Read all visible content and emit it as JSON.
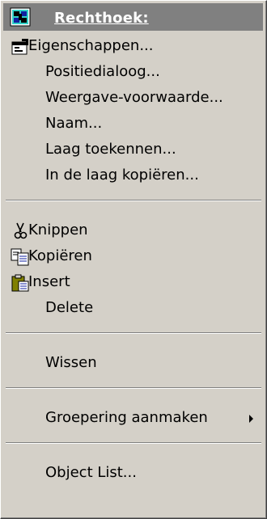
{
  "menu": {
    "header": {
      "label": "Rechthoek:",
      "icon": "rectangle-shape-icon"
    },
    "group1": [
      {
        "label": "Eigenschappen...",
        "icon": "properties-icon"
      },
      {
        "label": "Positiedialoog..."
      },
      {
        "label": "Weergave-voorwaarde..."
      },
      {
        "label": "Naam..."
      },
      {
        "label": "Laag toekennen..."
      },
      {
        "label": "In de laag kopiëren..."
      }
    ],
    "group2": [
      {
        "label": "Knippen",
        "icon": "scissors-icon"
      },
      {
        "label": "Kopiëren",
        "icon": "copy-icon"
      },
      {
        "label": "Insert",
        "icon": "paste-icon"
      },
      {
        "label": "Delete"
      }
    ],
    "group3": [
      {
        "label": "Wissen"
      }
    ],
    "group4": [
      {
        "label": "Groepering aanmaken",
        "has_submenu": true
      }
    ],
    "group5": [
      {
        "label": "Object List..."
      }
    ]
  }
}
